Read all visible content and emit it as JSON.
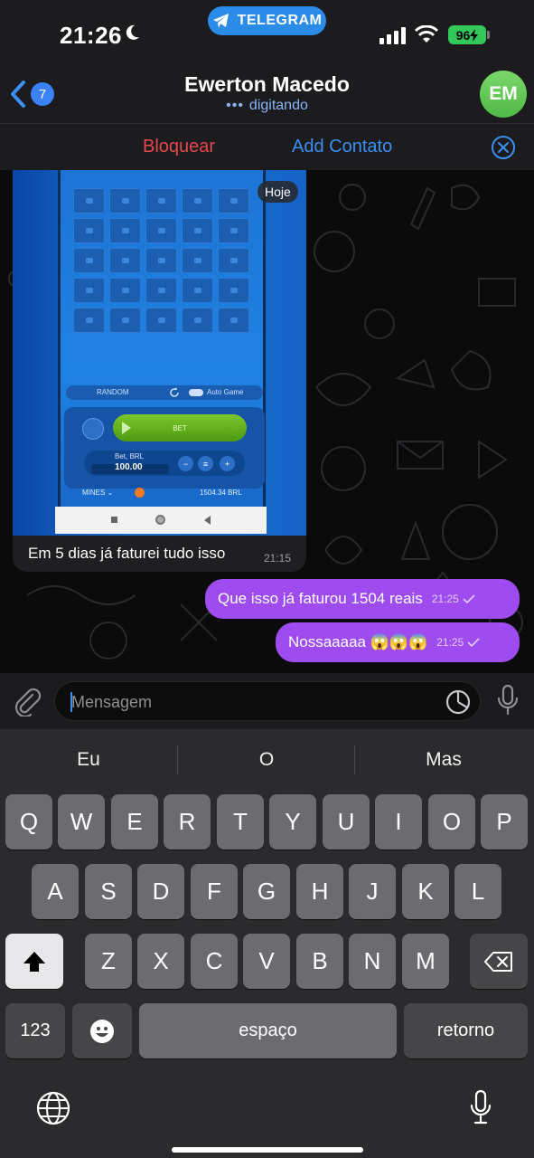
{
  "status_bar": {
    "time": "21:26",
    "app_pill": "TELEGRAM",
    "battery": "96"
  },
  "header": {
    "back_badge": "7",
    "contact_name": "Ewerton Macedo",
    "contact_status": "digitando",
    "avatar_initials": "EM"
  },
  "action_bar": {
    "block_label": "Bloquear",
    "add_contact_label": "Add Contato"
  },
  "chat": {
    "date_pill": "Hoje",
    "photo_message": {
      "caption": "Em 5 dias já faturei tudo isso",
      "time": "21:15",
      "game": {
        "random_label": "RANDOM",
        "auto_game_label": "Auto Game",
        "bet_button": "BET",
        "bet_label": "Bet, BRL",
        "bet_value": "100.00",
        "game_name": "MINES",
        "balance": "1504.34 BRL"
      }
    },
    "outgoing": [
      {
        "text": "Que isso já faturou 1504 reais",
        "time": "21:25"
      },
      {
        "text": "Nossaaaaa 😱😱😱",
        "time": "21:25"
      }
    ]
  },
  "input": {
    "placeholder": "Mensagem"
  },
  "keyboard": {
    "suggestions": [
      "Eu",
      "O",
      "Mas"
    ],
    "row1": [
      "Q",
      "W",
      "E",
      "R",
      "T",
      "Y",
      "U",
      "I",
      "O",
      "P"
    ],
    "row2": [
      "A",
      "S",
      "D",
      "F",
      "G",
      "H",
      "J",
      "K",
      "L"
    ],
    "row3": [
      "Z",
      "X",
      "C",
      "V",
      "B",
      "N",
      "M"
    ],
    "numbers_key": "123",
    "space_key": "espaço",
    "return_key": "retorno"
  },
  "colors": {
    "outgoing_bubble": "#9e4cf0",
    "accent_blue": "#3b8ff0",
    "block_red": "#e5484d",
    "telegram_pill": "#2a8be8"
  }
}
